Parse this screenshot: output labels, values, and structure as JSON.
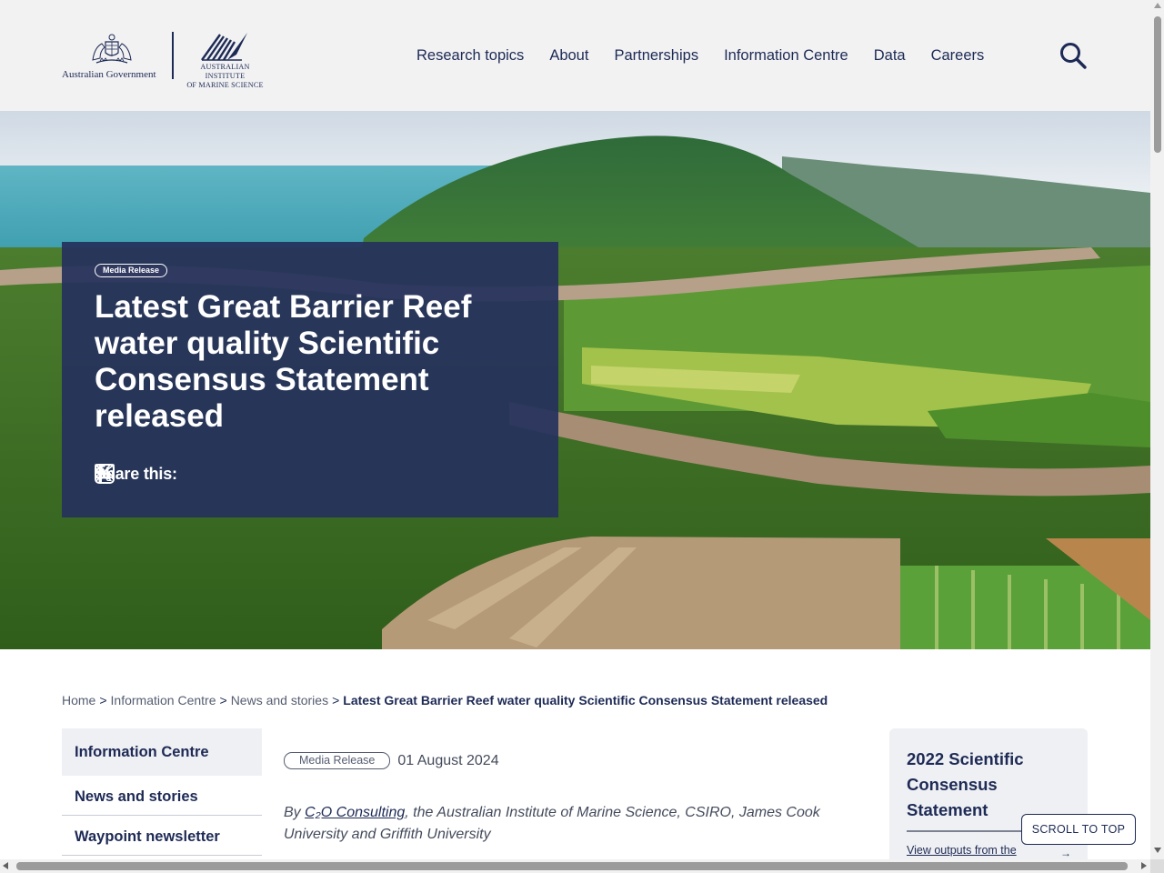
{
  "header": {
    "gov_logo_text": "Australian Government",
    "aims_logo_line1": "Australian Institute",
    "aims_logo_line2": "of Marine Science",
    "nav": [
      "Research topics",
      "About",
      "Partnerships",
      "Information Centre",
      "Data",
      "Careers"
    ],
    "search_icon": "search-icon"
  },
  "hero": {
    "badge": "Media Release",
    "title": "Latest Great Barrier Reef water quality Scientific Consensus Statement released",
    "share_label": "Share this:",
    "share_icons": [
      "facebook-icon",
      "x-icon",
      "linkedin-icon",
      "email-icon"
    ]
  },
  "breadcrumb": {
    "items": [
      "Home",
      "Information Centre",
      "News and stories"
    ],
    "separator": ">",
    "current": "Latest Great Barrier Reef water quality Scientific Consensus Statement released"
  },
  "sidenav": {
    "heading": "Information Centre",
    "items": [
      "News and stories",
      "Waypoint newsletter"
    ]
  },
  "article": {
    "badge": "Media Release",
    "date": "01 August 2024",
    "byline_prefix": "By ",
    "byline_link": "C₂O Consulting",
    "byline_rest": ", the Australian Institute of Marine Science, CSIRO, James Cook University and Griffith University"
  },
  "side_card": {
    "title": "2022 Scientific Consensus Statement",
    "link": "View outputs from the",
    "arrow": "→"
  },
  "scroll_top": "SCROLL TO TOP",
  "colors": {
    "navy": "#1d2a55",
    "header_bg": "#f2f2f3",
    "card_bg": "#26315c",
    "panel_bg": "#eff0f3"
  }
}
